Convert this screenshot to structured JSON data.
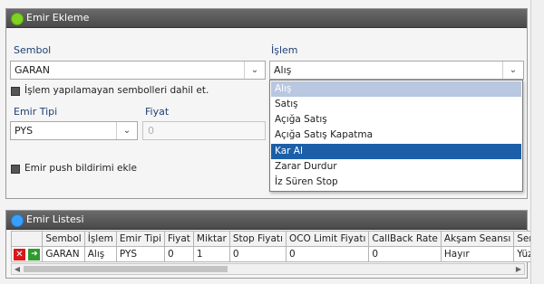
{
  "order_panel": {
    "title": "Emir Ekleme",
    "header_dot_color": "#7ed321",
    "symbol_label": "Sembol",
    "symbol_value": "GARAN",
    "operation_label": "İşlem",
    "operation_value": "Alış",
    "include_unlisted_label": "İşlem yapılamayan sembolleri dahil et.",
    "order_type_label": "Emir Tipi",
    "order_type_value": "PYS",
    "price_label": "Fiyat",
    "price_placeholder": "0",
    "push_label": "Emir push bildirimi ekle",
    "operation_options": [
      "Alış",
      "Satış",
      "Açığa Satış",
      "Açığa Satış Kapatma",
      "Kar Al",
      "Zarar Durdur",
      "İz Süren Stop"
    ],
    "selected_option": "Alış",
    "hovered_option": "Kar Al"
  },
  "list_panel": {
    "title": "Emir Listesi",
    "header_dot_color": "#3aa0ff",
    "columns": [
      "Sembol",
      "İşlem",
      "Emir Tipi",
      "Fiyat",
      "Miktar",
      "Stop Fiyatı",
      "OCO Limit Fiyatı",
      "CallBack Rate",
      "Akşam Seansı",
      "Sentetik E"
    ],
    "rows": [
      [
        "GARAN",
        "Alış",
        "PYS",
        "0",
        "1",
        "0",
        "0",
        "0",
        "Hayır",
        "Yüzde"
      ]
    ]
  }
}
